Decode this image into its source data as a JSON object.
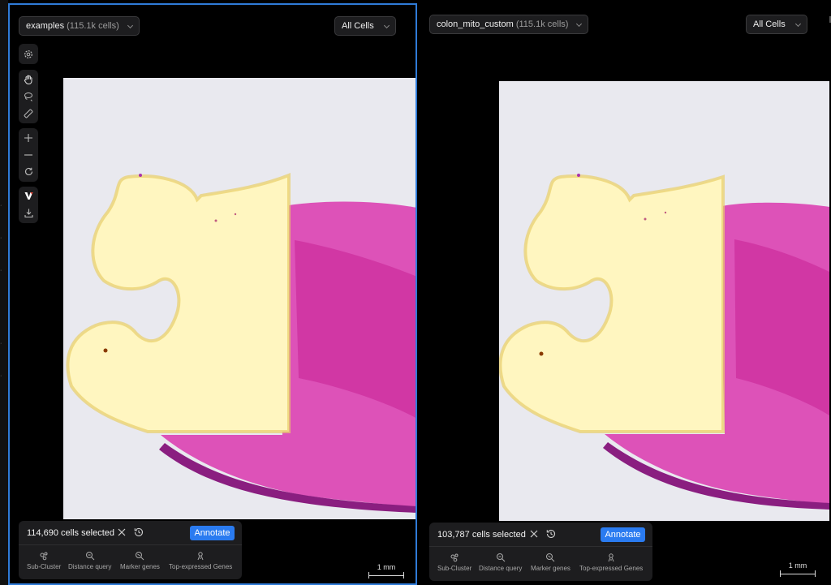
{
  "viewers": [
    {
      "dataset_name": "examples",
      "dataset_count": "(115.1k cells)",
      "cell_filter": "All Cells",
      "selection": {
        "count_label": "114,690 cells selected",
        "annotate_label": "Annotate"
      }
    },
    {
      "dataset_name": "colon_mito_custom",
      "dataset_count": "(115.1k cells)",
      "cell_filter": "All Cells",
      "selection": {
        "count_label": "103,787 cells selected",
        "annotate_label": "Annotate"
      }
    }
  ],
  "actions": [
    {
      "label": "Sub-Cluster",
      "icon": "sub-cluster-icon"
    },
    {
      "label": "Distance query",
      "icon": "distance-query-icon"
    },
    {
      "label": "Marker genes",
      "icon": "marker-genes-icon"
    },
    {
      "label": "Top-expressed Genes",
      "icon": "top-expressed-genes-icon"
    }
  ],
  "toolbar_icons": [
    "gear-icon",
    "hand-pan-icon",
    "lasso-icon",
    "ruler-icon",
    "zoom-in-icon",
    "zoom-out-icon",
    "reset-rotate-icon",
    "logo-icon",
    "download-icon"
  ],
  "scale_bar_label": "1 mm",
  "colors": {
    "selected_border": "#2f7bd8",
    "annotate_button": "#2a7bf0",
    "panel_bg": "#1d1d1f",
    "slide_bg": "#e9e9ef",
    "overlay_yellow": "#fff6c0",
    "he_pink": "#dd52b8"
  }
}
